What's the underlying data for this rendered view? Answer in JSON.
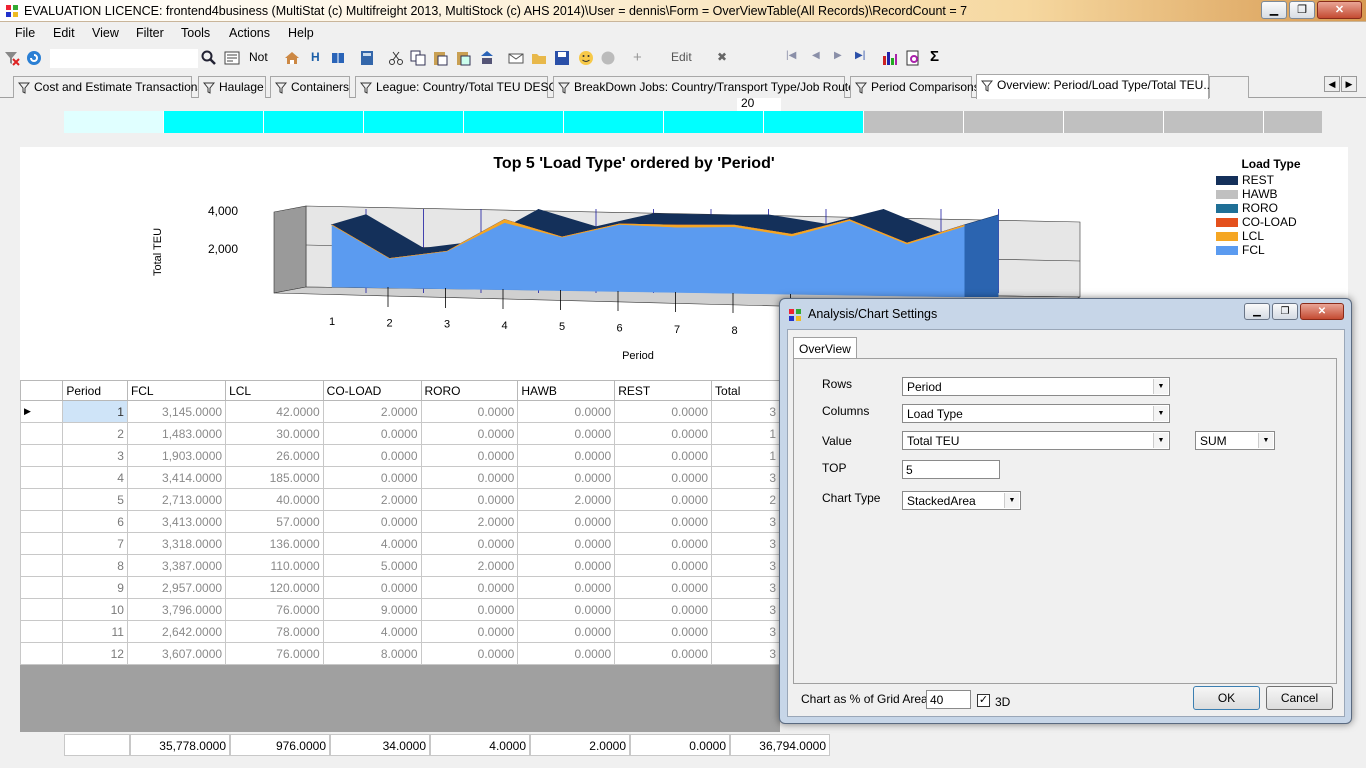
{
  "window": {
    "title": "EVALUATION LICENCE: frontend4business (MultiStat (c) Multifreight 2013, MultiStock (c) AHS 2014)\\User = dennis\\Form = OverViewTable(All Records)\\RecordCount = 7",
    "min_glyph": "▁",
    "max_glyph": "❐",
    "close_glyph": "✕"
  },
  "menu": [
    "File",
    "Edit",
    "View",
    "Filter",
    "Tools",
    "Actions",
    "Help"
  ],
  "toolbar": {
    "not_label": "Not",
    "h_label": "H",
    "edit_label": "Edit",
    "x_glyph": "✖",
    "record_input": "20",
    "nav_first": "|◀",
    "nav_prev": "◀",
    "nav_next": "▶",
    "nav_last": "▶|",
    "sigma": "Σ",
    "plus": "+"
  },
  "tabs": [
    "Cost and Estimate Transactions",
    "Haulage",
    "Containers",
    "League: Country/Total TEU DESC",
    "BreakDown Jobs: Country/Transport Type/Job Route...",
    "Period Comparisons",
    "Overview: Period/Load Type/Total TEU..."
  ],
  "tab_scroll": {
    "left": "◀",
    "right": "▶"
  },
  "chart_data": {
    "type": "area",
    "stacked": true,
    "three_d": true,
    "title": "Top 5  'Load Type' ordered by 'Period'",
    "xlabel": "Period",
    "ylabel": "Total TEU",
    "categories": [
      "1",
      "2",
      "3",
      "4",
      "5",
      "6",
      "7",
      "8",
      "9",
      "10",
      "11",
      "12"
    ],
    "visible_x_ticks": [
      "1",
      "2",
      "3",
      "4",
      "5",
      "6",
      "7",
      "8"
    ],
    "y_ticks": [
      "2,000",
      "4,000"
    ],
    "ylim": [
      0,
      4000
    ],
    "legend_title": "Load Type",
    "legend_position": "right",
    "series": [
      {
        "name": "FCL",
        "color": "#5b9bf0",
        "values": [
          3145,
          1483,
          1903,
          3414,
          2713,
          3413,
          3318,
          3387,
          2957,
          3796,
          2642,
          3607
        ]
      },
      {
        "name": "LCL",
        "color": "#f5a623",
        "values": [
          42,
          30,
          26,
          185,
          40,
          57,
          136,
          110,
          120,
          76,
          78,
          76
        ]
      },
      {
        "name": "CO-LOAD",
        "color": "#e4501c",
        "values": [
          2,
          0,
          0,
          0,
          2,
          0,
          4,
          5,
          0,
          9,
          4,
          8
        ]
      },
      {
        "name": "RORO",
        "color": "#1f6f96",
        "values": [
          0,
          0,
          0,
          0,
          0,
          2,
          0,
          2,
          0,
          0,
          0,
          0
        ]
      },
      {
        "name": "HAWB",
        "color": "#c0c0c0",
        "values": [
          0,
          0,
          0,
          0,
          2,
          0,
          0,
          0,
          0,
          0,
          0,
          0
        ]
      },
      {
        "name": "REST",
        "color": "#14305a",
        "values": [
          0,
          0,
          0,
          0,
          0,
          0,
          0,
          0,
          0,
          0,
          0,
          0
        ]
      }
    ]
  },
  "grid": {
    "columns": [
      "Period",
      "FCL",
      "LCL",
      "CO-LOAD",
      "RORO",
      "HAWB",
      "REST",
      "Total"
    ],
    "rows": [
      [
        "1",
        "3,145.0000",
        "42.0000",
        "2.0000",
        "0.0000",
        "0.0000",
        "0.0000",
        "3"
      ],
      [
        "2",
        "1,483.0000",
        "30.0000",
        "0.0000",
        "0.0000",
        "0.0000",
        "0.0000",
        "1"
      ],
      [
        "3",
        "1,903.0000",
        "26.0000",
        "0.0000",
        "0.0000",
        "0.0000",
        "0.0000",
        "1"
      ],
      [
        "4",
        "3,414.0000",
        "185.0000",
        "0.0000",
        "0.0000",
        "0.0000",
        "0.0000",
        "3"
      ],
      [
        "5",
        "2,713.0000",
        "40.0000",
        "2.0000",
        "0.0000",
        "2.0000",
        "0.0000",
        "2"
      ],
      [
        "6",
        "3,413.0000",
        "57.0000",
        "0.0000",
        "2.0000",
        "0.0000",
        "0.0000",
        "3"
      ],
      [
        "7",
        "3,318.0000",
        "136.0000",
        "4.0000",
        "0.0000",
        "0.0000",
        "0.0000",
        "3"
      ],
      [
        "8",
        "3,387.0000",
        "110.0000",
        "5.0000",
        "2.0000",
        "0.0000",
        "0.0000",
        "3"
      ],
      [
        "9",
        "2,957.0000",
        "120.0000",
        "0.0000",
        "0.0000",
        "0.0000",
        "0.0000",
        "3"
      ],
      [
        "10",
        "3,796.0000",
        "76.0000",
        "9.0000",
        "0.0000",
        "0.0000",
        "0.0000",
        "3"
      ],
      [
        "11",
        "2,642.0000",
        "78.0000",
        "4.0000",
        "0.0000",
        "0.0000",
        "0.0000",
        "3"
      ],
      [
        "12",
        "3,607.0000",
        "76.0000",
        "8.0000",
        "0.0000",
        "0.0000",
        "0.0000",
        "3"
      ]
    ],
    "totals": [
      "35,778.0000",
      "976.0000",
      "34.0000",
      "4.0000",
      "2.0000",
      "0.0000",
      "36,794.0000"
    ],
    "row_indicator": "▶"
  },
  "dialog": {
    "title": "Analysis/Chart Settings",
    "tab": "OverView",
    "rows_label": "Rows",
    "rows_value": "Period",
    "columns_label": "Columns",
    "columns_value": "Load Type",
    "value_label": "Value",
    "value_value": "Total TEU",
    "agg_value": "SUM",
    "top_label": "TOP",
    "top_value": "5",
    "chart_type_label": "Chart Type",
    "chart_type_value": "StackedArea",
    "chart_pct_label": "Chart as % of Grid Area",
    "chart_pct_value": "40",
    "three_d_label": "3D",
    "three_d_checked": "✓",
    "ok": "OK",
    "cancel": "Cancel",
    "dropdown_glyph": "▼"
  },
  "colors": {
    "progress_fill": "#00ffff",
    "progress_first": "#e0ffff",
    "progress_bg": "#c0c0c0",
    "accent": "#1b5fa8"
  },
  "progress": {
    "segments_total": 12,
    "segments_filled": 8
  }
}
